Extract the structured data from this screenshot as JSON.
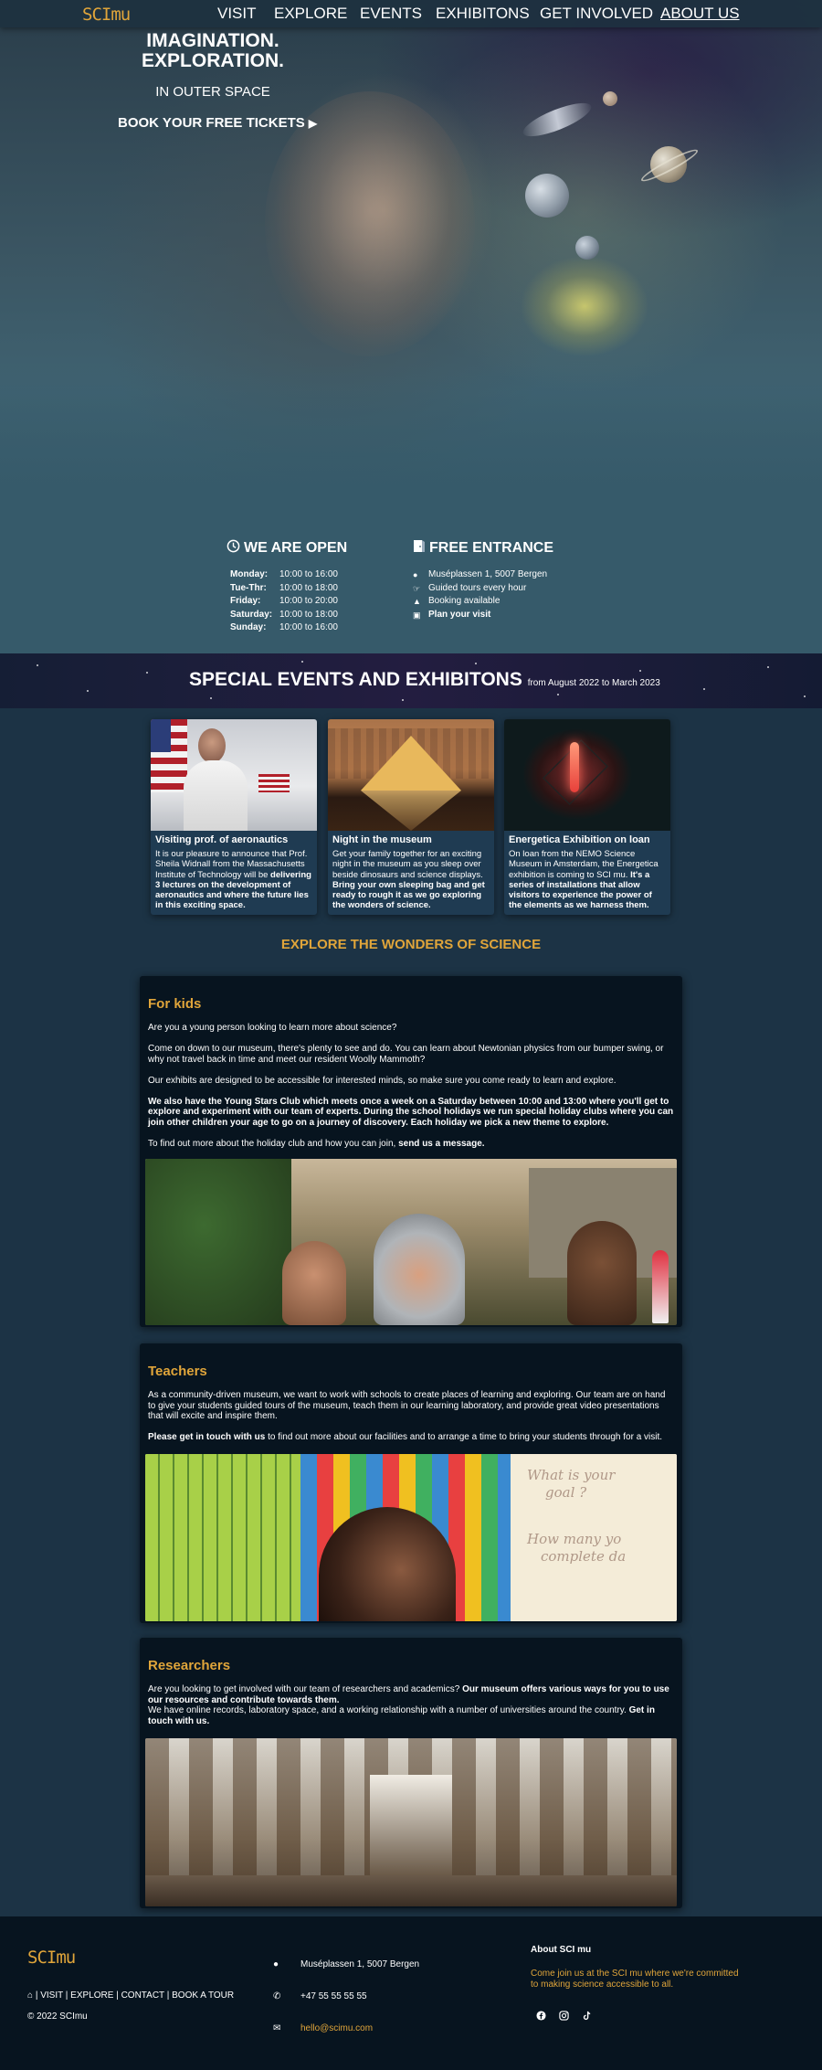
{
  "nav": {
    "logo": "SCImu",
    "items": [
      "VISIT",
      "EXPLORE",
      "EVENTS",
      "EXHIBITONS",
      "GET INVOLVED",
      "ABOUT US"
    ],
    "active": "ABOUT US"
  },
  "hero": {
    "title_line1": "IMAGINATION.",
    "title_line2": "EXPLORATION.",
    "subtitle": "IN OUTER SPACE",
    "cta": "BOOK YOUR FREE TICKETS",
    "cta_icon": "caret-right-icon"
  },
  "open": {
    "title": "WE ARE OPEN",
    "icon": "clock-icon",
    "hours": [
      {
        "day": "Monday:",
        "time": "10:00 to 16:00"
      },
      {
        "day": "Tue-Thr:",
        "time": "10:00 to 18:00"
      },
      {
        "day": "Friday:",
        "time": "10:00 to 20:00"
      },
      {
        "day": "Saturday:",
        "time": "10:00 to 18:00"
      },
      {
        "day": "Sunday:",
        "time": "10:00 to 16:00"
      }
    ]
  },
  "entrance": {
    "title": "FREE ENTRANCE",
    "icon": "door-icon",
    "items": [
      {
        "icon": "map-pin-icon",
        "text": "Muséplassen 1, 5007 Bergen"
      },
      {
        "icon": "guide-icon",
        "text": "Guided tours every hour"
      },
      {
        "icon": "building-icon",
        "text": "Booking available"
      },
      {
        "icon": "ticket-icon",
        "text": "Plan your visit"
      }
    ]
  },
  "events": {
    "title": "SPECIAL EVENTS AND EXHIBITONS",
    "range": "from August 2022 to March 2023",
    "cards": [
      {
        "title": "Visiting prof. of aeronautics",
        "text": "It is our pleasure to announce that Prof. Sheila Widnall from the Massachusetts Institute of Technology will be",
        "bold": "delivering 3 lectures on the development of aeronautics and where the future lies in this exciting space."
      },
      {
        "title": "Night in the museum",
        "text": "Get your family together for an exciting night in the museum as you sleep over beside dinosaurs and science displays.",
        "bold": "Bring your own sleeping bag and get ready to rough it as we go exploring the wonders of science."
      },
      {
        "title": "Energetica Exhibition on loan",
        "text": "On loan from the NEMO Science Museum in Amsterdam, the Energetica exhibition is coming to SCI mu.",
        "bold": "It's a series of installations that allow visitors to experience the power of the elements as we harness them."
      }
    ]
  },
  "explore_heading": "EXPLORE THE WONDERS OF SCIENCE",
  "kids": {
    "title": "For kids",
    "p1": "Are you a young person looking to learn more about science?",
    "p2": "Come on down to our museum, there's plenty to see and do. You can learn about Newtonian physics from our bumper swing, or why not travel back in time and meet our resident Woolly Mammoth?",
    "p3": "Our exhibits are designed to be accessible for interested minds, so make sure you come ready to learn and explore.",
    "p4": "We also have the Young Stars Club which meets once a week on a Saturday between 10:00 and 13:00 where you'll get to explore and experiment with our team of experts. During the school holidays we run special holiday clubs where you can join other children your age to go on a journey of discovery. Each holiday we pick a new theme to explore.",
    "p5_text": "To find out more about the holiday club and how you can join,",
    "p5_bold": "send us a message."
  },
  "teachers": {
    "title": "Teachers",
    "p1": "As a community-driven museum, we want to work with schools to create places of learning and exploring. Our team are on hand to give your students guided tours of the museum, teach them in our learning laboratory, and provide great video presentations that will excite and inspire them.",
    "p2_bold": "Please get in touch with us",
    "p2_text": "to find out more about our facilities and to arrange a time to bring your students through for a visit.",
    "board_text": [
      "What is your",
      "goal ?",
      "How many yo",
      "complete da"
    ]
  },
  "researchers": {
    "title": "Researchers",
    "p1_text": "Are you looking to get involved with our team of researchers and academics?",
    "p1_bold": "Our museum offers various ways for you to use our resources and contribute towards them.",
    "p2_text": "We have online records, laboratory space, and a working relationship with a number of universities around the country.",
    "p2_bold": "Get in touch with us."
  },
  "footer": {
    "logo": "SCImu",
    "links": "| VISIT | EXPLORE | CONTACT | BOOK A TOUR",
    "copyright": "© 2022 SCImu",
    "address": "Muséplassen 1, 5007 Bergen",
    "phone": "+47 55 55 55 55",
    "email": "hello@scimu.com",
    "about_title": "About SCI mu",
    "about_text": "Come join us at the SCI mu where we're committed to making science accessible to all.",
    "social": [
      "facebook-icon",
      "instagram-icon",
      "tiktok-icon"
    ]
  },
  "colors": {
    "accent": "#e0a53a",
    "page_bg": "#1c3345",
    "section_bg": "#07141f"
  }
}
